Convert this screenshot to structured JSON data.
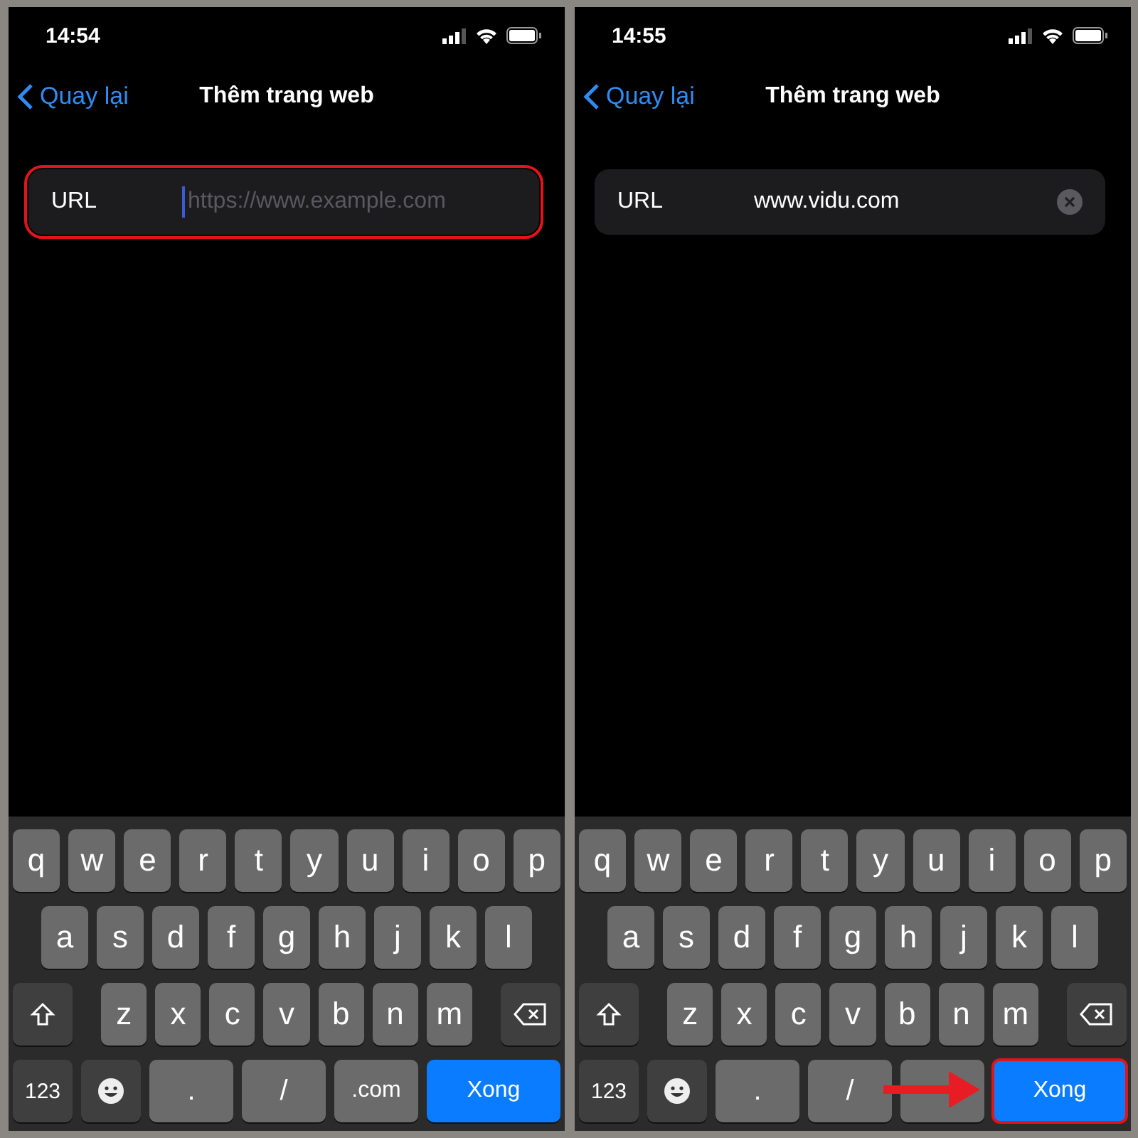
{
  "screens": [
    {
      "time": "14:54",
      "back": "Quay lại",
      "title": "Thêm trang web",
      "field": {
        "label": "URL",
        "placeholder": "https://www.example.com",
        "focused": true,
        "highlighted": true
      },
      "keyboard": {
        "rows": [
          [
            "q",
            "w",
            "e",
            "r",
            "t",
            "y",
            "u",
            "i",
            "o",
            "p"
          ],
          [
            "a",
            "s",
            "d",
            "f",
            "g",
            "h",
            "j",
            "k",
            "l"
          ],
          [
            "z",
            "x",
            "c",
            "v",
            "b",
            "n",
            "m"
          ]
        ],
        "bottom": [
          {
            "kind": "mode",
            "label": "123"
          },
          {
            "kind": "emoji"
          },
          {
            "kind": "key",
            "label": "."
          },
          {
            "kind": "key",
            "label": "/"
          },
          {
            "kind": "key",
            "label": ".com"
          },
          {
            "kind": "done",
            "label": "Xong",
            "highlighted": false
          }
        ]
      },
      "pointer_arrow": false
    },
    {
      "time": "14:55",
      "back": "Quay lại",
      "title": "Thêm trang web",
      "field": {
        "label": "URL",
        "value": "www.vidu.com",
        "focused": false,
        "highlighted": false,
        "clear_button": true
      },
      "keyboard": {
        "rows": [
          [
            "q",
            "w",
            "e",
            "r",
            "t",
            "y",
            "u",
            "i",
            "o",
            "p"
          ],
          [
            "a",
            "s",
            "d",
            "f",
            "g",
            "h",
            "j",
            "k",
            "l"
          ],
          [
            "z",
            "x",
            "c",
            "v",
            "b",
            "n",
            "m"
          ]
        ],
        "bottom": [
          {
            "kind": "mode",
            "label": "123"
          },
          {
            "kind": "emoji"
          },
          {
            "kind": "key",
            "label": "."
          },
          {
            "kind": "key",
            "label": "/"
          },
          {
            "kind": "blank"
          },
          {
            "kind": "done",
            "label": "Xong",
            "highlighted": true
          }
        ]
      },
      "pointer_arrow": true
    }
  ]
}
